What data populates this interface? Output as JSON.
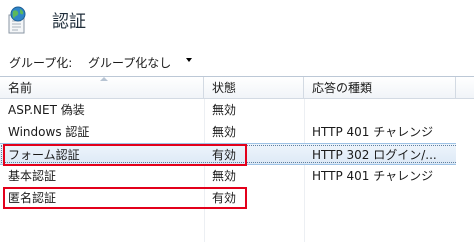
{
  "header": {
    "title": "認証",
    "icon": "globe-page-icon"
  },
  "toolbar": {
    "group_label": "グループ化:",
    "group_value": "グループ化なし"
  },
  "grid": {
    "columns": [
      "名前",
      "状態",
      "応答の種類"
    ],
    "rows": [
      {
        "name": "ASP.NET 偽装",
        "status": "無効",
        "response": ""
      },
      {
        "name": "Windows 認証",
        "status": "無効",
        "response": "HTTP 401 チャレンジ"
      },
      {
        "name": "フォーム認証",
        "status": "有効",
        "response": "HTTP 302 ログイン/..."
      },
      {
        "name": "基本認証",
        "status": "無効",
        "response": "HTTP 401 チャレンジ"
      },
      {
        "name": "匿名認証",
        "status": "有効",
        "response": ""
      }
    ]
  },
  "colors": {
    "highlight": "#e3001b",
    "selection": "#dde9f6"
  }
}
